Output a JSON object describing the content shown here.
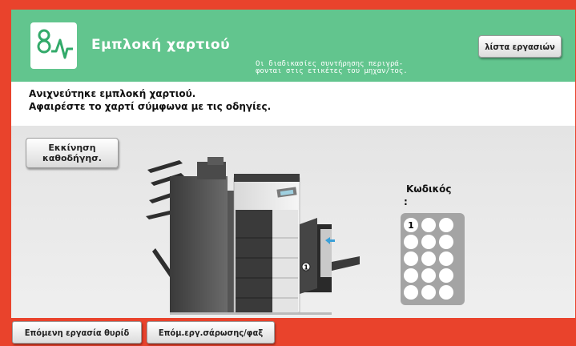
{
  "header": {
    "title": "Εμπλοκή χαρτιού",
    "jobs_button": "λίστα εργασιών",
    "notice_line1": "Οι διαδικασίες συντήρησης περιγρά-",
    "notice_line2": "φονται στις ετικέτες του μηχαν/τος.",
    "icon": "paper-jam-icon"
  },
  "message": {
    "line1": "Ανιχνεύτηκε εμπλοκή χαρτιού.",
    "line2": "Αφαιρέστε το χαρτί σύμφωνα με τις οδηγίες."
  },
  "guidance_button": {
    "line1": "Εκκίνηση",
    "line2": "καθοδήγησ."
  },
  "machine": {
    "jam_marker": "1"
  },
  "code": {
    "label": "Κωδικός",
    "colon": ":",
    "highlighted_key": "1"
  },
  "footer": {
    "next_job_door": "Επόμενη εργασία θυρίδ",
    "next_scan_fax": "Επόμ.εργ.σάρωσης/φαξ"
  },
  "colors": {
    "frame": "#e9432c",
    "header": "#62c58e"
  }
}
